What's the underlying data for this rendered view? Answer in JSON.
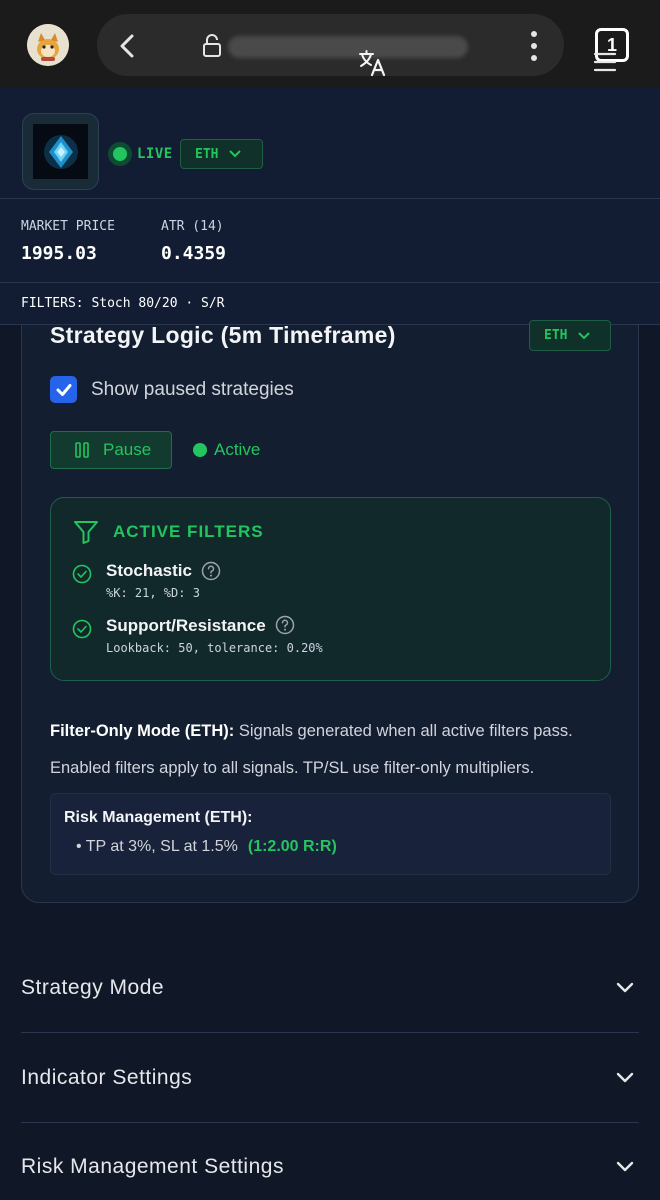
{
  "browser": {
    "tab_count": "1"
  },
  "header": {
    "status": "LIVE",
    "symbol": "ETH"
  },
  "stats": {
    "market_price_label": "MARKET PRICE",
    "market_price_value": "1995.03",
    "atr_label": "ATR (14)",
    "atr_value": "0.4359"
  },
  "filters_bar": "FILTERS: Stoch 80/20 · S/R",
  "strategy": {
    "title": "Strategy Logic (5m Timeframe)",
    "symbol": "ETH",
    "show_paused_label": "Show paused strategies",
    "show_paused_checked": true,
    "pause_label": "Pause",
    "status_label": "Active",
    "active_filters_heading": "ACTIVE FILTERS",
    "filters": [
      {
        "name": "Stochastic",
        "params": "%K: 21, %D: 3"
      },
      {
        "name": "Support/Resistance",
        "params": "Lookback: 50, tolerance: 0.20%"
      }
    ],
    "mode_title": "Filter-Only Mode (ETH):",
    "mode_desc": "Signals generated when all active filters pass.",
    "mode_desc2": "Enabled filters apply to all signals. TP/SL use filter-only multipliers.",
    "risk_title": "Risk Management (ETH):",
    "risk_item": "TP at 3%, SL at 1.5%",
    "risk_ratio": "(1:2.00 R:R)"
  },
  "sections": [
    {
      "label": "Strategy Mode"
    },
    {
      "label": "Indicator Settings"
    },
    {
      "label": "Risk Management Settings"
    }
  ],
  "colors": {
    "accent_green": "#22c55e",
    "background": "#101827",
    "checkbox_blue": "#2563eb"
  },
  "icons": [
    "back-icon",
    "lock-icon",
    "more-vert-icon",
    "translate-icon",
    "menu-icon",
    "chevron-down-icon",
    "pause-icon",
    "filter-icon",
    "check-circle-icon",
    "help-icon",
    "check-icon"
  ]
}
